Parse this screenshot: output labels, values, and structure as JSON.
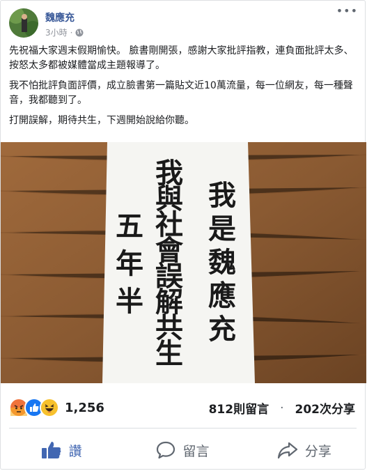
{
  "post": {
    "author": "魏應充",
    "time": "3小時",
    "paragraphs": [
      "先祝福大家週末假期愉快。 臉書剛開張，感謝大家批評指教，連負面批評太多、按怒太多都被媒體當成主題報導了。",
      "我不怕批評負面評價，成立臉書第一篇貼文近10萬流量，每一位網友，每一種聲音，我都聽到了。",
      "打開誤解，期待共生，下週開始說給你聽。"
    ],
    "photo": {
      "columns": [
        [
          "我",
          "是",
          "魏",
          "應",
          "充"
        ],
        [
          "我",
          "與",
          "社",
          "會",
          "誤",
          "解",
          "共",
          "生"
        ],
        [
          "五",
          "年",
          "半"
        ]
      ]
    }
  },
  "engagement": {
    "reaction_count": "1,256",
    "reaction_icons": [
      "angry-icon",
      "like-icon",
      "haha-icon"
    ],
    "comments": "812則留言",
    "separator": "·",
    "shares": "202次分享"
  },
  "actions": {
    "like": "讚",
    "comment": "留言",
    "share": "分享"
  },
  "colors": {
    "link": "#385898",
    "like_active": "#4267b2",
    "muted": "#606770",
    "wood": "#8a5a32"
  }
}
